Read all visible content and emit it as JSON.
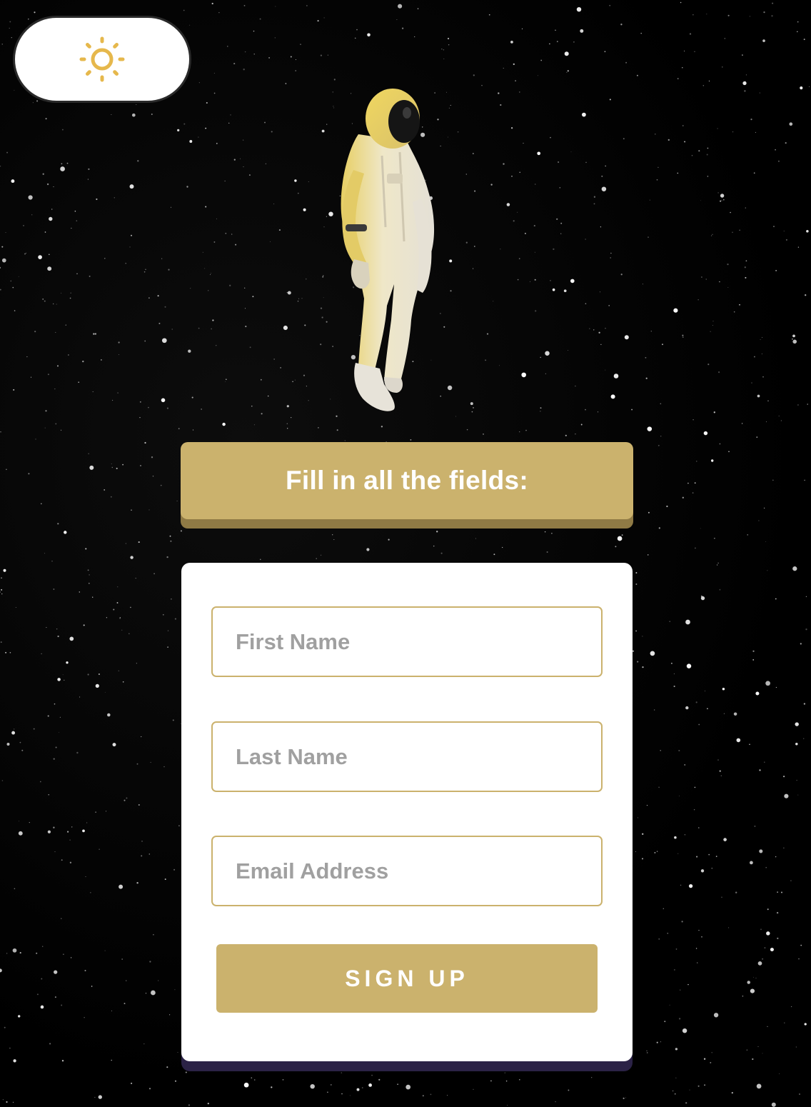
{
  "colors": {
    "accent_gold": "#cbb26d",
    "accent_gold_shadow": "#8f7a45",
    "card_shadow": "#2b2246",
    "background": "#000000",
    "sun_icon": "#e6b84c"
  },
  "theme_toggle": {
    "icon": "sun-icon"
  },
  "hero": {
    "illustration": "astronaut-illustration"
  },
  "banner": {
    "text": "Fill in all the fields:"
  },
  "form": {
    "first_name_placeholder": "First Name",
    "last_name_placeholder": "Last Name",
    "email_placeholder": "Email Address",
    "submit_label": "SIGN UP"
  }
}
